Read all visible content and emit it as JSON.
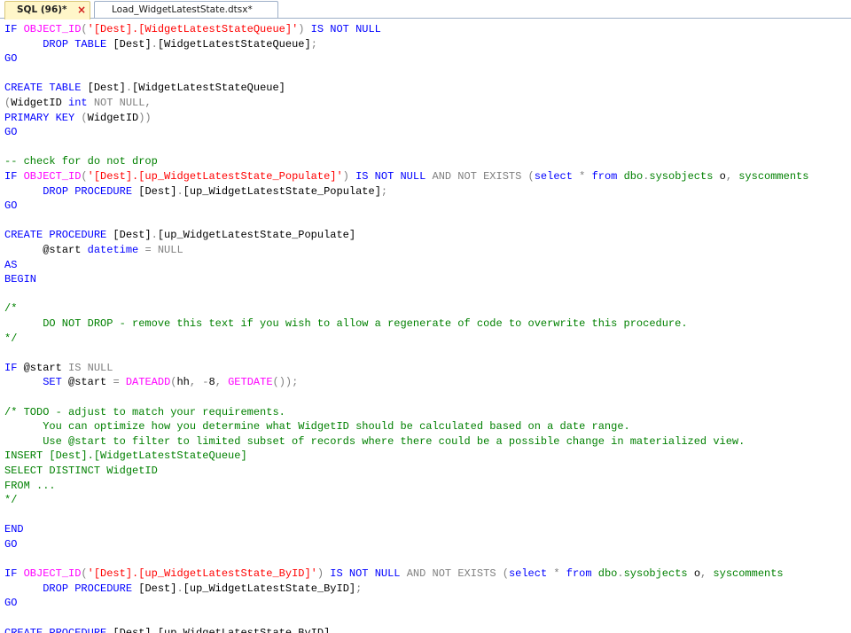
{
  "tabs": [
    {
      "label": "SQL (96)*",
      "active": true,
      "close_glyph": "×"
    },
    {
      "label": "Load_WidgetLatestState.dtsx*",
      "active": false
    }
  ],
  "code_lines": [
    [
      [
        "kw",
        "IF "
      ],
      [
        "fn",
        "OBJECT_ID"
      ],
      [
        "gray",
        "("
      ],
      [
        "str",
        "'[Dest].[WidgetLatestStateQueue]'"
      ],
      [
        "gray",
        ")"
      ],
      [
        "kw",
        " IS NOT NULL"
      ]
    ],
    [
      [
        "plain",
        "      "
      ],
      [
        "kw",
        "DROP TABLE "
      ],
      [
        "plain",
        "[Dest]"
      ],
      [
        "gray",
        "."
      ],
      [
        "plain",
        "[WidgetLatestStateQueue]"
      ],
      [
        "gray",
        ";"
      ]
    ],
    [
      [
        "kw",
        "GO"
      ]
    ],
    [],
    [
      [
        "kw",
        "CREATE TABLE "
      ],
      [
        "plain",
        "[Dest]"
      ],
      [
        "gray",
        "."
      ],
      [
        "plain",
        "[WidgetLatestStateQueue]"
      ]
    ],
    [
      [
        "gray",
        "("
      ],
      [
        "plain",
        "WidgetID "
      ],
      [
        "kw",
        "int "
      ],
      [
        "gray",
        "NOT NULL"
      ],
      [
        "gray",
        ","
      ]
    ],
    [
      [
        "kw",
        "PRIMARY KEY "
      ],
      [
        "gray",
        "("
      ],
      [
        "plain",
        "WidgetID"
      ],
      [
        "gray",
        "))"
      ]
    ],
    [
      [
        "kw",
        "GO"
      ]
    ],
    [],
    [
      [
        "cmt",
        "-- check for do not drop"
      ]
    ],
    [
      [
        "kw",
        "IF "
      ],
      [
        "fn",
        "OBJECT_ID"
      ],
      [
        "gray",
        "("
      ],
      [
        "str",
        "'[Dest].[up_WidgetLatestState_Populate]'"
      ],
      [
        "gray",
        ")"
      ],
      [
        "kw",
        " IS NOT NULL "
      ],
      [
        "gray",
        "AND NOT EXISTS "
      ],
      [
        "gray",
        "("
      ],
      [
        "kw",
        "select "
      ],
      [
        "gray",
        "* "
      ],
      [
        "kw",
        "from "
      ],
      [
        "sys",
        "dbo"
      ],
      [
        "gray",
        "."
      ],
      [
        "sys",
        "sysobjects "
      ],
      [
        "plain",
        "o"
      ],
      [
        "gray",
        ", "
      ],
      [
        "sys",
        "syscomments"
      ]
    ],
    [
      [
        "plain",
        "      "
      ],
      [
        "kw",
        "DROP PROCEDURE "
      ],
      [
        "plain",
        "[Dest]"
      ],
      [
        "gray",
        "."
      ],
      [
        "plain",
        "[up_WidgetLatestState_Populate]"
      ],
      [
        "gray",
        ";"
      ]
    ],
    [
      [
        "kw",
        "GO"
      ]
    ],
    [],
    [
      [
        "kw",
        "CREATE PROCEDURE "
      ],
      [
        "plain",
        "[Dest]"
      ],
      [
        "gray",
        "."
      ],
      [
        "plain",
        "[up_WidgetLatestState_Populate]"
      ]
    ],
    [
      [
        "plain",
        "      "
      ],
      [
        "plain",
        "@start "
      ],
      [
        "kw",
        "datetime "
      ],
      [
        "gray",
        "= "
      ],
      [
        "gray",
        "NULL"
      ]
    ],
    [
      [
        "kw",
        "AS"
      ]
    ],
    [
      [
        "kw",
        "BEGIN"
      ]
    ],
    [],
    [
      [
        "cmt",
        "/*"
      ]
    ],
    [
      [
        "cmt",
        "      DO NOT DROP - remove this text if you wish to allow a regenerate of code to overwrite this procedure."
      ]
    ],
    [
      [
        "cmt",
        "*/"
      ]
    ],
    [],
    [
      [
        "kw",
        "IF "
      ],
      [
        "plain",
        "@start "
      ],
      [
        "gray",
        "IS NULL"
      ]
    ],
    [
      [
        "plain",
        "      "
      ],
      [
        "kw",
        "SET "
      ],
      [
        "plain",
        "@start "
      ],
      [
        "gray",
        "= "
      ],
      [
        "fn",
        "DATEADD"
      ],
      [
        "gray",
        "("
      ],
      [
        "plain",
        "hh"
      ],
      [
        "gray",
        ", "
      ],
      [
        "gray",
        "-"
      ],
      [
        "plain",
        "8"
      ],
      [
        "gray",
        ", "
      ],
      [
        "fn",
        "GETDATE"
      ],
      [
        "gray",
        "());"
      ]
    ],
    [],
    [
      [
        "cmt",
        "/* TODO - adjust to match your requirements."
      ]
    ],
    [
      [
        "cmt",
        "      You can optimize how you determine what WidgetID should be calculated based on a date range."
      ]
    ],
    [
      [
        "cmt",
        "      Use @start to filter to limited subset of records where there could be a possible change in materialized view."
      ]
    ],
    [
      [
        "cmt",
        "INSERT [Dest].[WidgetLatestStateQueue]"
      ]
    ],
    [
      [
        "cmt",
        "SELECT DISTINCT WidgetID"
      ]
    ],
    [
      [
        "cmt",
        "FROM ..."
      ]
    ],
    [
      [
        "cmt",
        "*/"
      ]
    ],
    [],
    [
      [
        "kw",
        "END"
      ]
    ],
    [
      [
        "kw",
        "GO"
      ]
    ],
    [],
    [
      [
        "kw",
        "IF "
      ],
      [
        "fn",
        "OBJECT_ID"
      ],
      [
        "gray",
        "("
      ],
      [
        "str",
        "'[Dest].[up_WidgetLatestState_ByID]'"
      ],
      [
        "gray",
        ")"
      ],
      [
        "kw",
        " IS NOT NULL "
      ],
      [
        "gray",
        "AND NOT EXISTS "
      ],
      [
        "gray",
        "("
      ],
      [
        "kw",
        "select "
      ],
      [
        "gray",
        "* "
      ],
      [
        "kw",
        "from "
      ],
      [
        "sys",
        "dbo"
      ],
      [
        "gray",
        "."
      ],
      [
        "sys",
        "sysobjects "
      ],
      [
        "plain",
        "o"
      ],
      [
        "gray",
        ", "
      ],
      [
        "sys",
        "syscomments"
      ]
    ],
    [
      [
        "plain",
        "      "
      ],
      [
        "kw",
        "DROP PROCEDURE "
      ],
      [
        "plain",
        "[Dest]"
      ],
      [
        "gray",
        "."
      ],
      [
        "plain",
        "[up_WidgetLatestState_ByID]"
      ],
      [
        "gray",
        ";"
      ]
    ],
    [
      [
        "kw",
        "GO"
      ]
    ],
    [],
    [
      [
        "kw",
        "CREATE PROCEDURE "
      ],
      [
        "plain",
        "[Dest]"
      ],
      [
        "gray",
        "."
      ],
      [
        "plain",
        "[up_WidgetLatestState_ByID]"
      ]
    ]
  ],
  "colors": {
    "keyword": "#0000ff",
    "function": "#ff00ff",
    "string": "#ff0000",
    "comment": "#008000",
    "operator": "#808080",
    "system_object": "#008000"
  }
}
